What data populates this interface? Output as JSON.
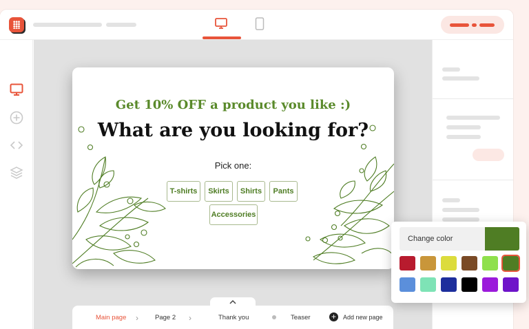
{
  "toolbar": {
    "device_desktop_icon": "desktop-icon",
    "device_mobile_icon": "mobile-icon"
  },
  "sidebar": {
    "items": [
      {
        "icon": "desktop-icon"
      },
      {
        "icon": "plus-circle-icon"
      },
      {
        "icon": "code-icon"
      },
      {
        "icon": "layers-icon"
      }
    ]
  },
  "popup_card": {
    "offer": "Get 10% OFF a product you like :)",
    "headline": "What are you looking for?",
    "prompt": "Pick one:",
    "options": [
      "T-shirts",
      "Skirts",
      "Shirts",
      "Pants",
      "Accessories"
    ]
  },
  "pages_nav": {
    "items": [
      "Main page",
      "Page 2",
      "Thank you",
      "Teaser"
    ],
    "add_label": "Add new page"
  },
  "color_picker": {
    "label": "Change color",
    "current_color": "#4f7d24",
    "swatches": [
      "#b81b2e",
      "#c9963a",
      "#dcdc3c",
      "#7a4a26",
      "#8fe04c",
      "#4f7d24",
      "#5b8fdb",
      "#7ee3b6",
      "#1d2e9c",
      "#000000",
      "#9b1bdb",
      "#6e14c9"
    ]
  },
  "colors": {
    "accent": "#e8543a",
    "leaf_green": "#4f7d24"
  }
}
